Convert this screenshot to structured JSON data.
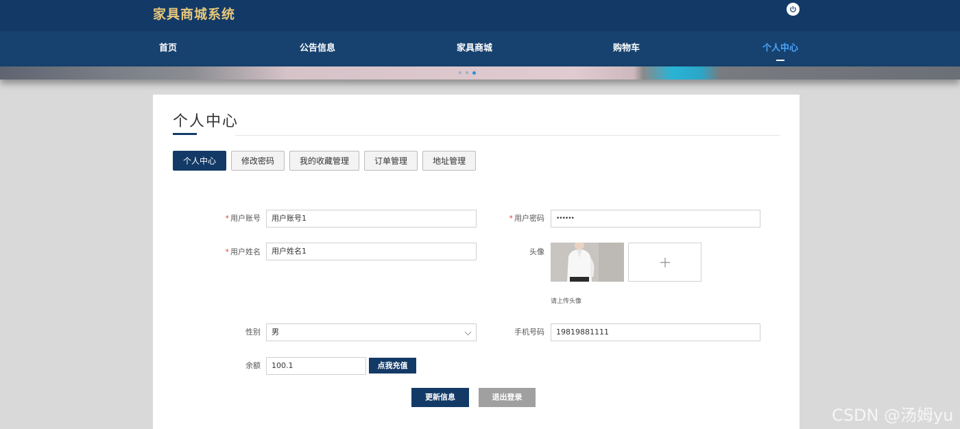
{
  "header": {
    "brand": "家具商城系统",
    "power_icon": "power-icon"
  },
  "nav": {
    "items": [
      {
        "label": "首页",
        "active": false
      },
      {
        "label": "公告信息",
        "active": false
      },
      {
        "label": "家具商城",
        "active": false
      },
      {
        "label": "购物车",
        "active": false
      },
      {
        "label": "个人中心",
        "active": true
      }
    ]
  },
  "carousel": {
    "dot_count": 3,
    "active_dot": 3
  },
  "page": {
    "title": "个人中心"
  },
  "tabs": [
    {
      "label": "个人中心",
      "active": true
    },
    {
      "label": "修改密码",
      "active": false
    },
    {
      "label": "我的收藏管理",
      "active": false
    },
    {
      "label": "订单管理",
      "active": false
    },
    {
      "label": "地址管理",
      "active": false
    }
  ],
  "form": {
    "required_mark": "*",
    "account": {
      "label": "用户账号",
      "value": "用户账号1"
    },
    "password": {
      "label": "用户密码",
      "value": "••••••"
    },
    "name": {
      "label": "用户姓名",
      "value": "用户姓名1"
    },
    "avatar": {
      "label": "头像",
      "hint": "请上传头像",
      "upload_icon": "plus-icon"
    },
    "gender": {
      "label": "性别",
      "value": "男"
    },
    "phone": {
      "label": "手机号码",
      "value": "19819881111"
    },
    "balance": {
      "label": "余额",
      "value": "100.1",
      "recharge_label": "点我充值"
    },
    "update_label": "更新信息",
    "logout_label": "退出登录"
  },
  "colors": {
    "primary": "#133a67",
    "accent": "#4aa6ff",
    "brand_text": "#e8c77a"
  },
  "watermark": "CSDN @汤姆yu"
}
